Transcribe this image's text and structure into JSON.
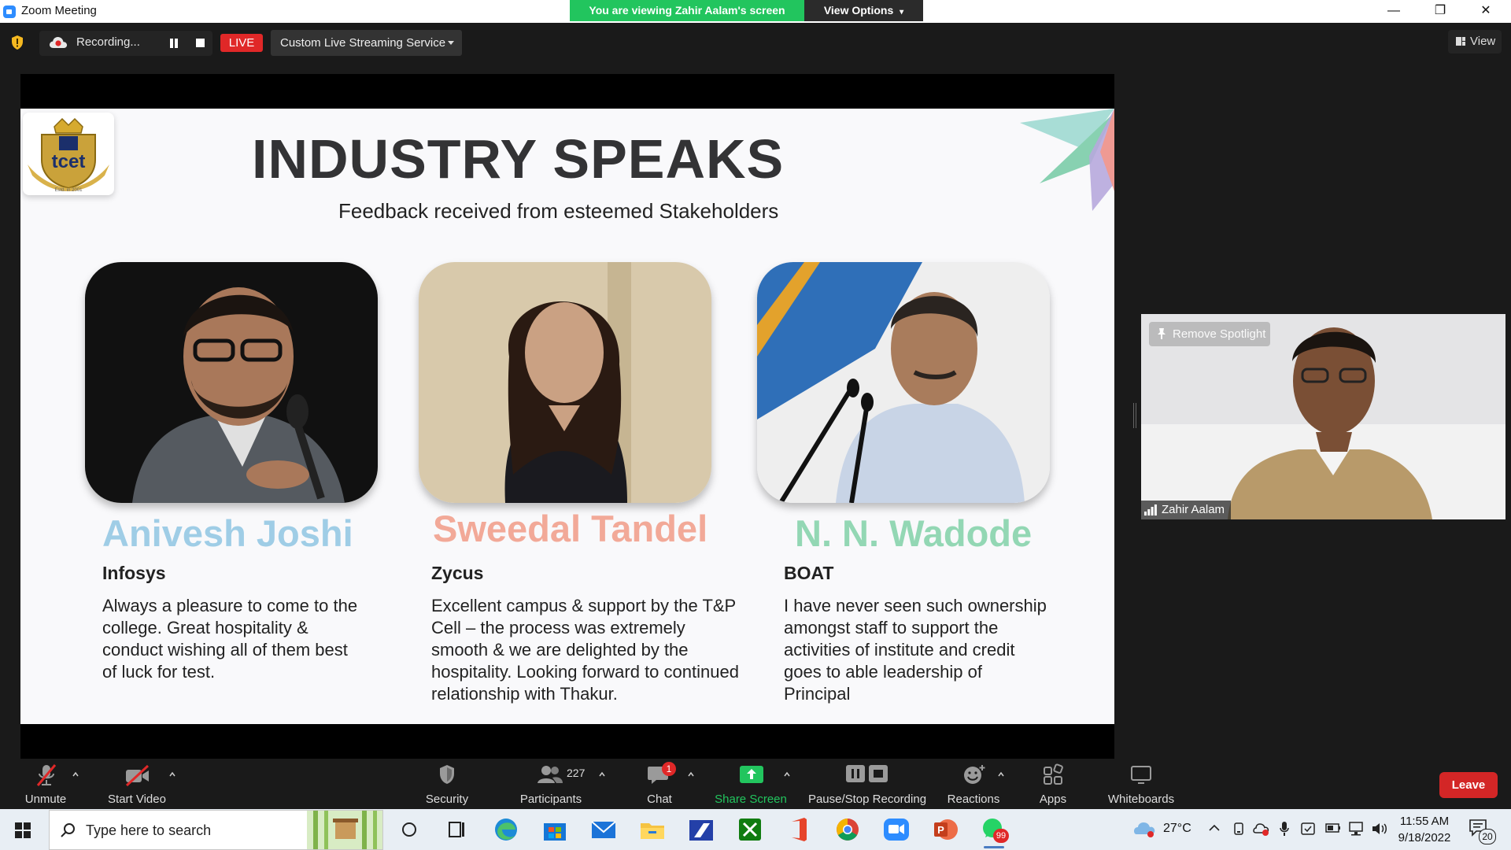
{
  "window": {
    "title": "Zoom Meeting",
    "controls": [
      "—",
      "❐",
      "✕"
    ]
  },
  "banner": {
    "viewing_text": "You are viewing Zahir Aalam's screen",
    "view_options_label": "View Options"
  },
  "meeting_bar": {
    "recording_label": "Recording...",
    "live_label": "LIVE",
    "stream_service_label": "Custom Live Streaming Service",
    "view_label": "View"
  },
  "slide": {
    "title": "INDUSTRY SPEAKS",
    "subtitle": "Feedback received from esteemed Stakeholders",
    "logo_text": "tcet",
    "logo_caption": "Estd. in 2001",
    "speakers": [
      {
        "name": "Anivesh Joshi",
        "company": "Infosys",
        "feedback": "Always a pleasure to come to the college. Great hospitality & conduct wishing all of them best of luck for test.",
        "name_color": "#9fcde6"
      },
      {
        "name": "Sweedal Tandel",
        "company": "Zycus",
        "feedback": "Excellent campus & support by the T&P Cell – the process was extremely smooth & we are delighted by the hospitality. Looking forward to continued relationship with Thakur.",
        "name_color": "#f2a998"
      },
      {
        "name": "N. N. Wadode",
        "company": "BOAT",
        "feedback": "I have never seen such ownership amongst staff to support the activities of institute and credit goes to able leadership of Principal",
        "name_color": "#93d7b4"
      }
    ]
  },
  "spotlight": {
    "remove_label": "Remove Spotlight",
    "participant_name": "Zahir Aalam"
  },
  "toolbar": {
    "unmute": "Unmute",
    "start_video": "Start Video",
    "security": "Security",
    "participants": "Participants",
    "participants_count": "227",
    "chat": "Chat",
    "chat_badge": "1",
    "share_screen": "Share Screen",
    "pause_stop_recording": "Pause/Stop Recording",
    "reactions": "Reactions",
    "apps": "Apps",
    "whiteboards": "Whiteboards",
    "leave": "Leave"
  },
  "taskbar": {
    "search_placeholder": "Type here to search",
    "weather": "27°C",
    "time": "11:55 AM",
    "date": "9/18/2022",
    "notifications": "20",
    "whatsapp_badge": "99"
  },
  "colors": {
    "share_green": "#22c55e",
    "live_red": "#e02828",
    "leave_red": "#d32626",
    "toolbar_bg": "#1a1a1a"
  }
}
